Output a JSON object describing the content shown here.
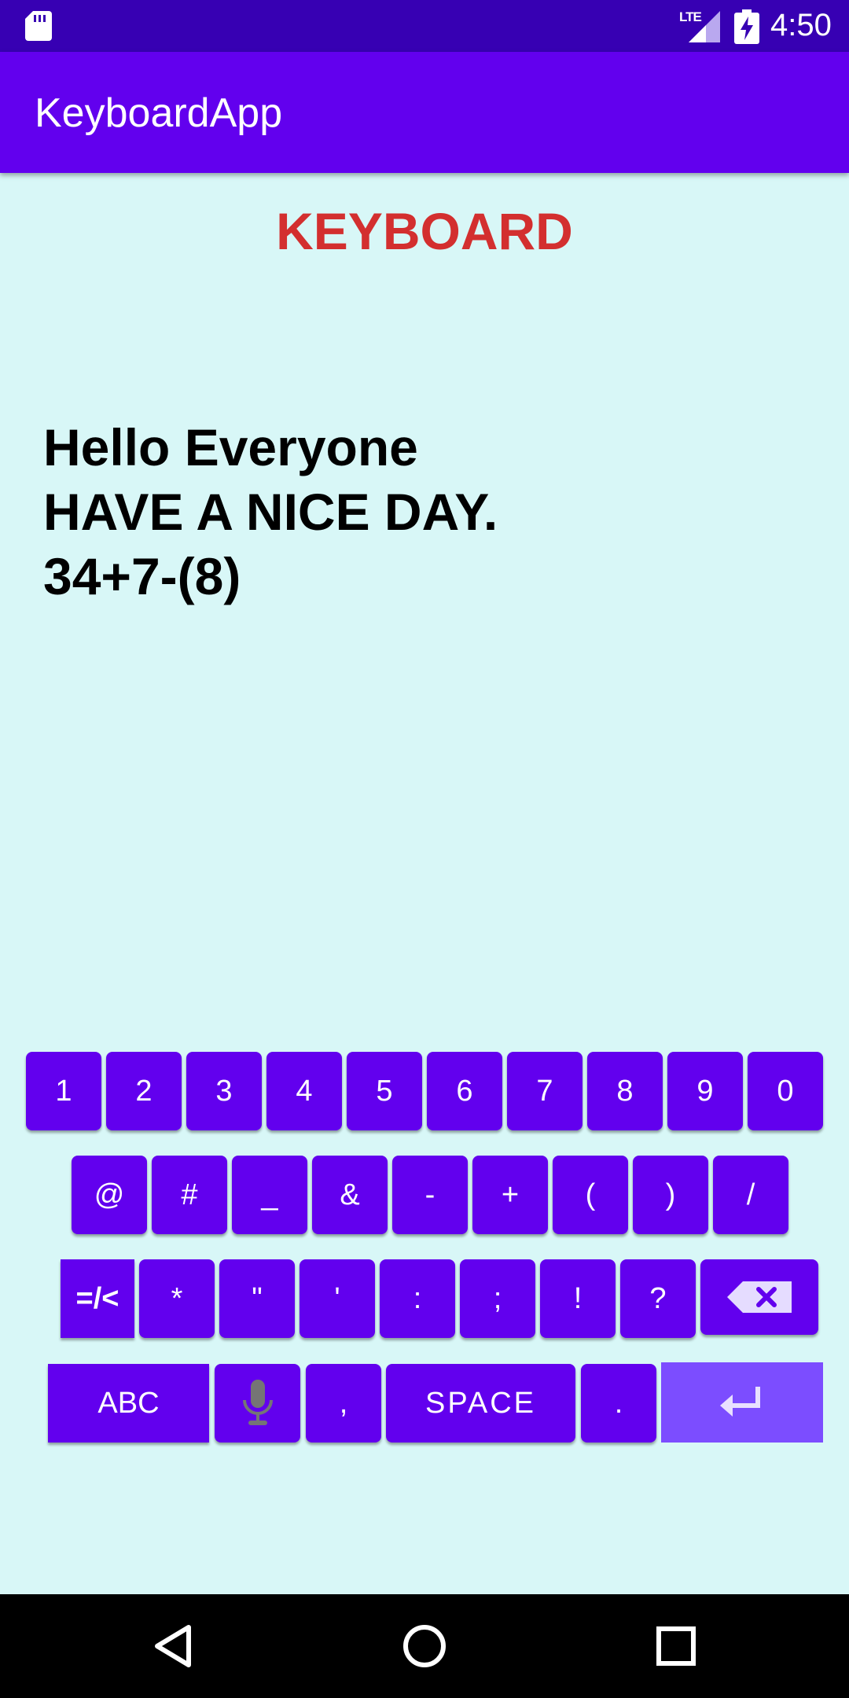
{
  "status_bar": {
    "network": "LTE",
    "time": "4:50"
  },
  "app_bar": {
    "title": "KeyboardApp"
  },
  "heading": "KEYBOARD",
  "text_lines": [
    "Hello Everyone",
    "HAVE A NICE DAY.",
    "34+7-(8)"
  ],
  "keyboard": {
    "row1": [
      "1",
      "2",
      "3",
      "4",
      "5",
      "6",
      "7",
      "8",
      "9",
      "0"
    ],
    "row2": [
      "@",
      "#",
      "_",
      "&",
      "-",
      "+",
      "(",
      ")",
      "/"
    ],
    "row3": [
      "=/<",
      "*",
      "\"",
      "'",
      ":",
      ";",
      "!",
      "?"
    ],
    "row4": {
      "abc": "ABC",
      "comma": ",",
      "space": "SPACE",
      "period": "."
    }
  },
  "icons": {
    "sd_card": "sd-card-icon",
    "signal": "signal-icon",
    "battery": "battery-charging-icon",
    "mic": "microphone-icon",
    "backspace": "backspace-icon",
    "enter": "enter-icon",
    "back": "back-icon",
    "home": "home-icon",
    "recents": "recents-icon"
  },
  "colors": {
    "status_bar": "#3700b3",
    "app_bar": "#6200ee",
    "background": "#d8f7f7",
    "heading": "#d32f2f",
    "key": "#6200ee",
    "enter_key": "#7c4dff"
  }
}
